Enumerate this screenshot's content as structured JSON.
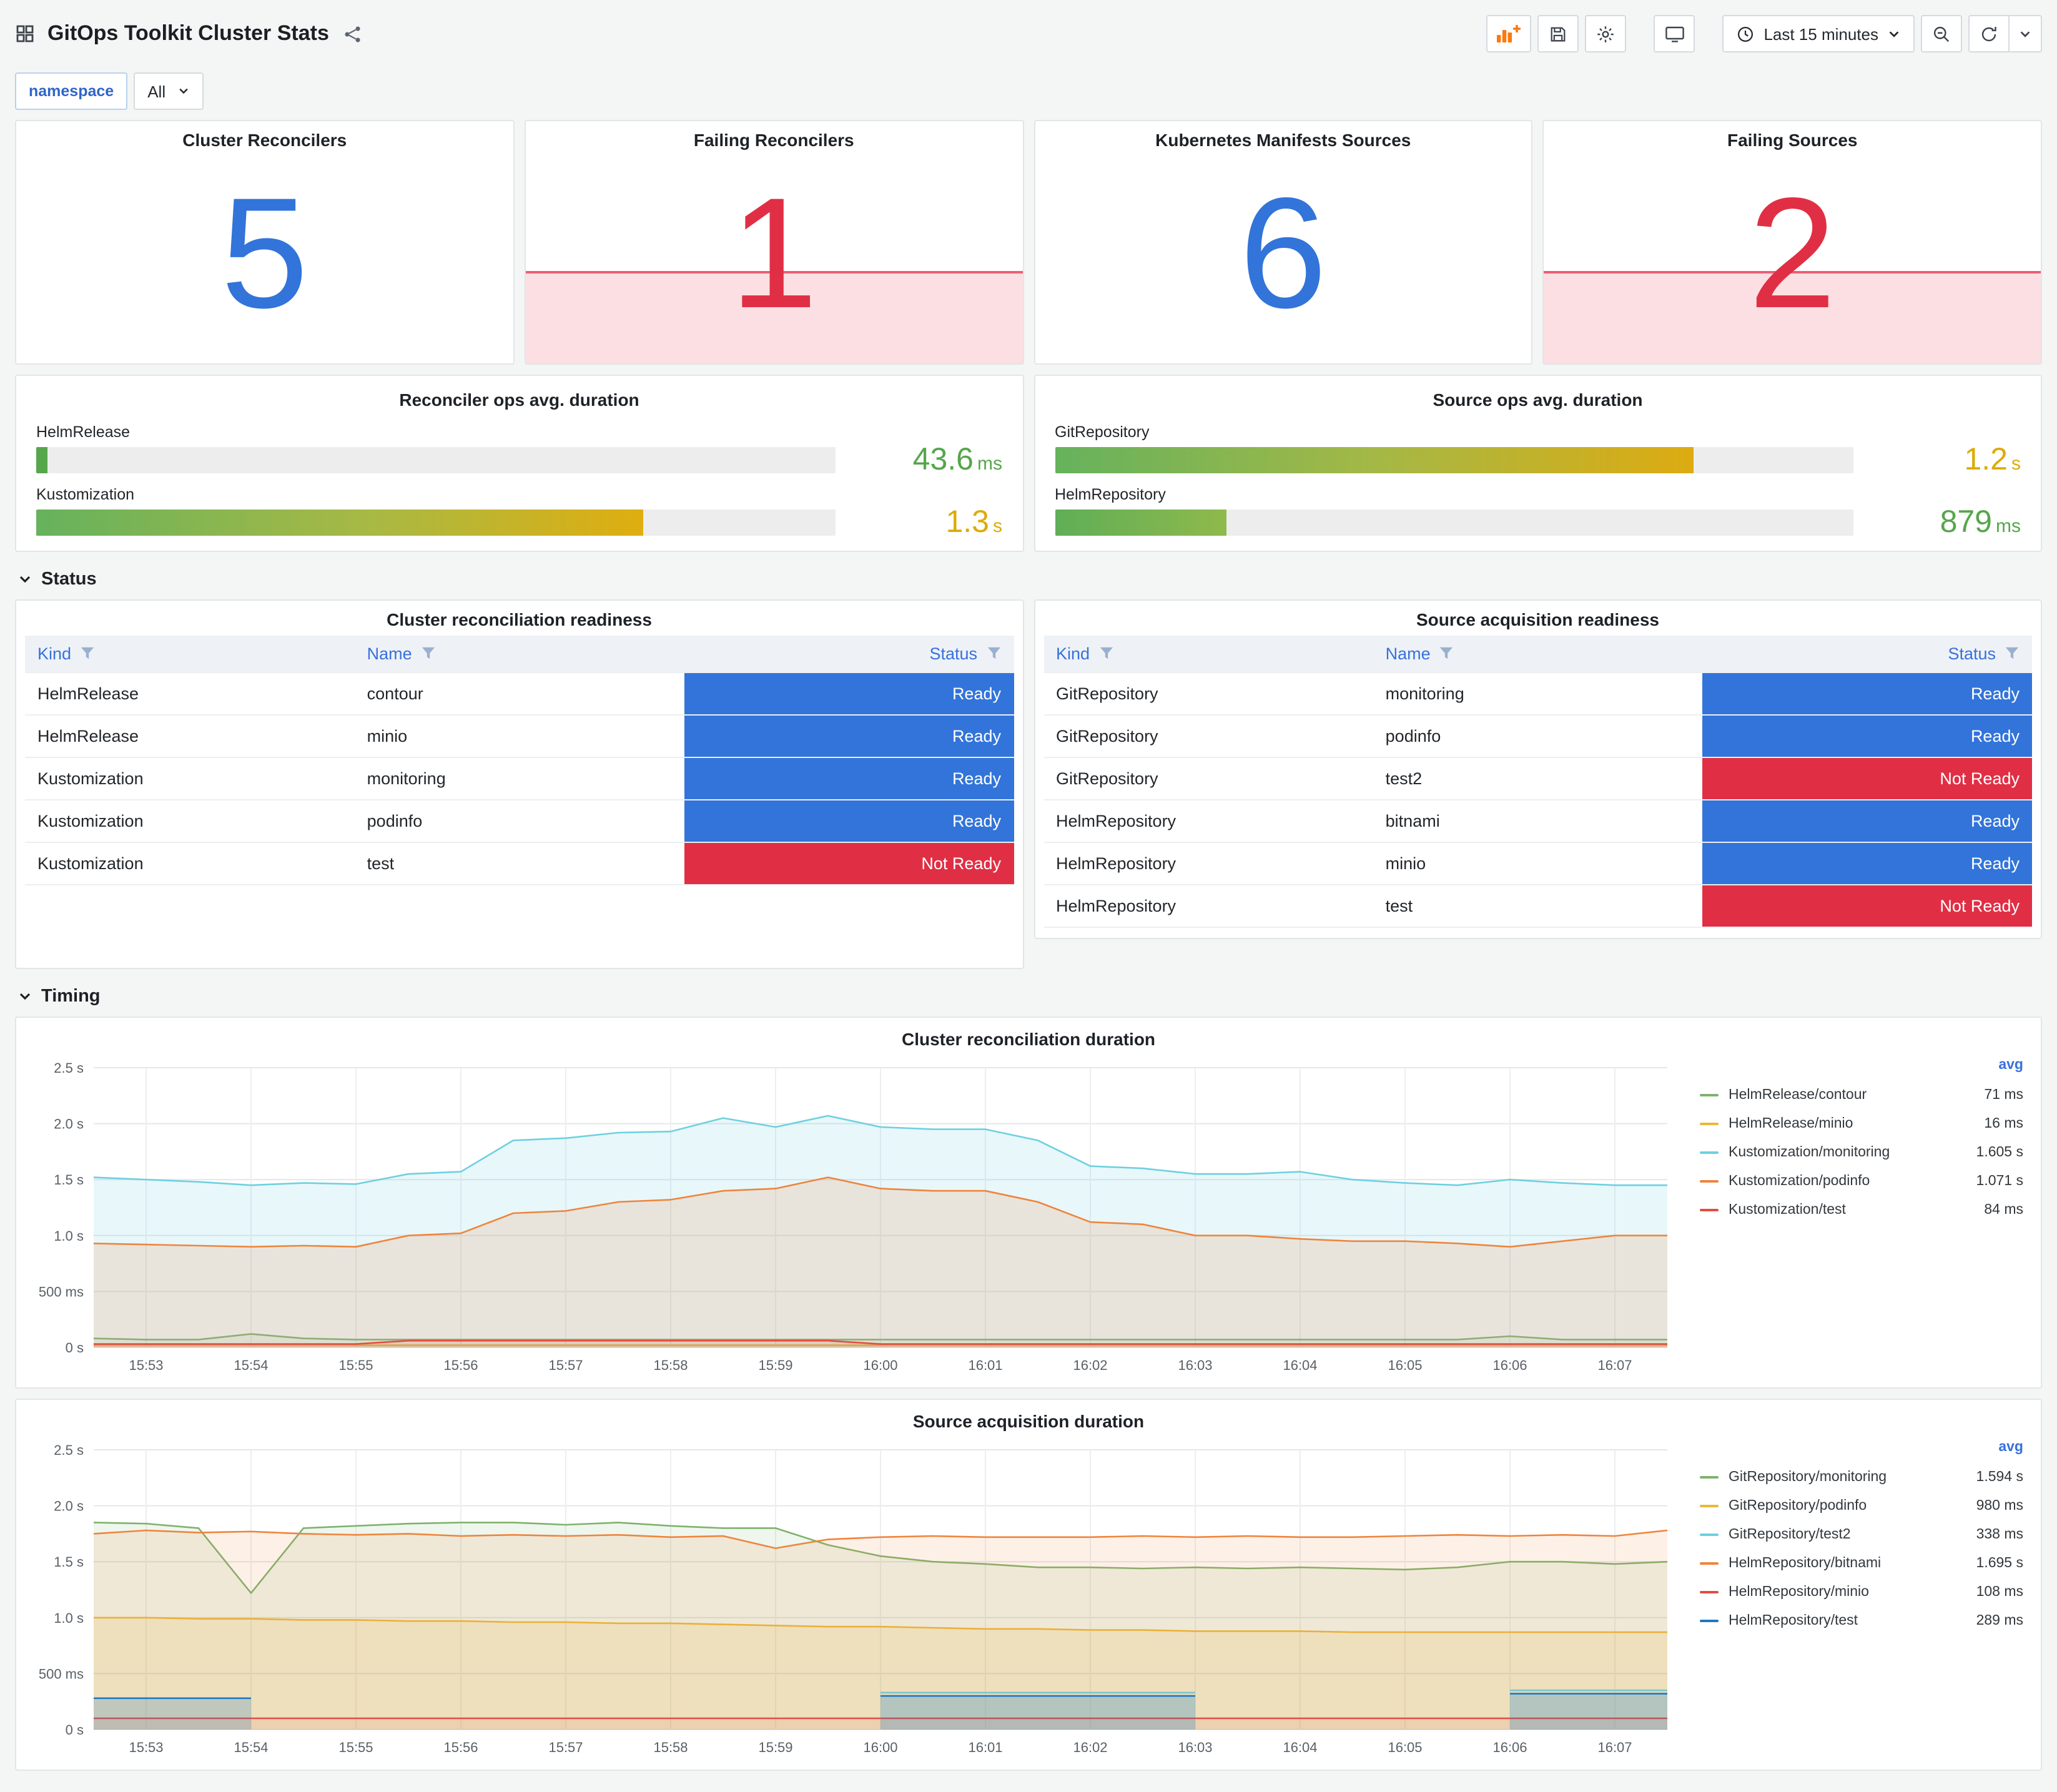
{
  "header": {
    "title": "GitOps Toolkit Cluster Stats",
    "time_range": "Last 15 minutes"
  },
  "filters": {
    "namespace_label": "namespace",
    "namespace_value": "All"
  },
  "stats": [
    {
      "title": "Cluster Reconcilers",
      "value": "5",
      "color": "#3274d9",
      "spark": false
    },
    {
      "title": "Failing Reconcilers",
      "value": "1",
      "color": "#e02f44",
      "spark": true
    },
    {
      "title": "Kubernetes Manifests Sources",
      "value": "6",
      "color": "#3274d9",
      "spark": false
    },
    {
      "title": "Failing Sources",
      "value": "2",
      "color": "#e02f44",
      "spark": true
    }
  ],
  "gauges": {
    "reconciler": {
      "title": "Reconciler ops avg. duration",
      "rows": [
        {
          "label": "HelmRelease",
          "value": "43.6",
          "unit": "ms",
          "percent": "1.4%",
          "valueColor": "#56a64b",
          "fill": "#56a64b"
        },
        {
          "label": "Kustomization",
          "value": "1.3",
          "unit": "s",
          "percent": "76%",
          "valueColor": "#dcab09",
          "fill": "linear-gradient(90deg,#66b25d 0%,#a8b944 55%,#dfae10 100%)"
        }
      ]
    },
    "source": {
      "title": "Source ops avg. duration",
      "rows": [
        {
          "label": "GitRepository",
          "value": "1.2",
          "unit": "s",
          "percent": "80%",
          "valueColor": "#dcab09",
          "fill": "linear-gradient(90deg,#66b25d 0%,#a4b846 50%,#ddab12 100%)"
        },
        {
          "label": "HelmRepository",
          "value": "879",
          "unit": "ms",
          "percent": "21.5%",
          "valueColor": "#56a64b",
          "fill": "linear-gradient(90deg,#5fae57,#8fb94c)"
        }
      ]
    }
  },
  "sections": {
    "status": "Status",
    "timing": "Timing"
  },
  "status_colors": {
    "Ready": "#3274d9",
    "Not Ready": "#e02f44"
  },
  "status": {
    "reconciliation": {
      "title": "Cluster reconciliation readiness",
      "columns": [
        "Kind",
        "Name",
        "Status"
      ],
      "rows": [
        [
          "HelmRelease",
          "contour",
          "Ready"
        ],
        [
          "HelmRelease",
          "minio",
          "Ready"
        ],
        [
          "Kustomization",
          "monitoring",
          "Ready"
        ],
        [
          "Kustomization",
          "podinfo",
          "Ready"
        ],
        [
          "Kustomization",
          "test",
          "Not Ready"
        ]
      ]
    },
    "source": {
      "title": "Source acquisition readiness",
      "columns": [
        "Kind",
        "Name",
        "Status"
      ],
      "rows": [
        [
          "GitRepository",
          "monitoring",
          "Ready"
        ],
        [
          "GitRepository",
          "podinfo",
          "Ready"
        ],
        [
          "GitRepository",
          "test2",
          "Not Ready"
        ],
        [
          "HelmRepository",
          "bitnami",
          "Ready"
        ],
        [
          "HelmRepository",
          "minio",
          "Ready"
        ],
        [
          "HelmRepository",
          "test",
          "Not Ready"
        ]
      ]
    }
  },
  "chart_data": [
    {
      "type": "line",
      "title": "Cluster reconciliation duration",
      "legend_header": "avg",
      "legend_position": "right",
      "grid": true,
      "ylim": [
        0,
        2.5
      ],
      "y_ticks": [
        {
          "v": 0,
          "label": "0 s"
        },
        {
          "v": 0.5,
          "label": "500 ms"
        },
        {
          "v": 1,
          "label": "1.0 s"
        },
        {
          "v": 1.5,
          "label": "1.5 s"
        },
        {
          "v": 2,
          "label": "2.0 s"
        },
        {
          "v": 2.5,
          "label": "2.5 s"
        }
      ],
      "x_ticks": [
        "15:53",
        "15:54",
        "15:55",
        "15:56",
        "15:57",
        "15:58",
        "15:59",
        "16:00",
        "16:01",
        "16:02",
        "16:03",
        "16:04",
        "16:05",
        "16:06",
        "16:07"
      ],
      "series": [
        {
          "name": "HelmRelease/contour",
          "avg": "71 ms",
          "color": "#7EB26D",
          "fill_opacity": 0.1,
          "values": [
            0.08,
            0.07,
            0.07,
            0.12,
            0.08,
            0.07,
            0.07,
            0.07,
            0.07,
            0.07,
            0.07,
            0.07,
            0.07,
            0.07,
            0.07,
            0.07,
            0.07,
            0.07,
            0.07,
            0.07,
            0.07,
            0.07,
            0.07,
            0.07,
            0.07,
            0.07,
            0.07,
            0.1,
            0.07,
            0.07,
            0.07
          ]
        },
        {
          "name": "HelmRelease/minio",
          "avg": "16 ms",
          "color": "#EAB839",
          "fill_opacity": 0.1,
          "values": [
            0.02,
            0.02,
            0.02,
            0.02,
            0.02,
            0.02,
            0.02,
            0.02,
            0.02,
            0.02,
            0.02,
            0.02,
            0.02,
            0.02,
            0.02,
            0.02,
            0.02,
            0.02,
            0.02,
            0.02,
            0.02,
            0.02,
            0.02,
            0.02,
            0.02,
            0.02,
            0.02,
            0.02,
            0.02,
            0.02,
            0.02
          ]
        },
        {
          "name": "Kustomization/monitoring",
          "avg": "1.605 s",
          "color": "#6ED0E0",
          "fill_opacity": 0.16,
          "values": [
            1.52,
            1.5,
            1.48,
            1.45,
            1.47,
            1.46,
            1.55,
            1.57,
            1.85,
            1.87,
            1.92,
            1.93,
            2.05,
            1.97,
            2.07,
            1.97,
            1.95,
            1.95,
            1.85,
            1.62,
            1.6,
            1.55,
            1.55,
            1.57,
            1.5,
            1.47,
            1.45,
            1.5,
            1.47,
            1.45,
            1.45
          ]
        },
        {
          "name": "Kustomization/podinfo",
          "avg": "1.071 s",
          "color": "#EF843C",
          "fill_opacity": 0.16,
          "values": [
            0.93,
            0.92,
            0.91,
            0.9,
            0.91,
            0.9,
            1.0,
            1.02,
            1.2,
            1.22,
            1.3,
            1.32,
            1.4,
            1.42,
            1.52,
            1.42,
            1.4,
            1.4,
            1.3,
            1.12,
            1.1,
            1.0,
            1.0,
            0.97,
            0.95,
            0.95,
            0.93,
            0.9,
            0.95,
            1.0,
            1.0
          ]
        },
        {
          "name": "Kustomization/test",
          "avg": "84 ms",
          "color": "#E24D42",
          "fill_opacity": 0.12,
          "values": [
            0.03,
            0.03,
            0.03,
            0.03,
            0.03,
            0.03,
            0.06,
            0.06,
            0.06,
            0.06,
            0.06,
            0.06,
            0.06,
            0.06,
            0.06,
            0.03,
            0.03,
            0.03,
            0.03,
            0.03,
            0.03,
            0.03,
            0.03,
            0.03,
            0.03,
            0.03,
            0.03,
            0.03,
            0.03,
            0.03,
            0.03
          ]
        }
      ]
    },
    {
      "type": "line",
      "title": "Source acquisition duration",
      "legend_header": "avg",
      "legend_position": "right",
      "grid": true,
      "ylim": [
        0,
        2.5
      ],
      "y_ticks": [
        {
          "v": 0,
          "label": "0 s"
        },
        {
          "v": 0.5,
          "label": "500 ms"
        },
        {
          "v": 1,
          "label": "1.0 s"
        },
        {
          "v": 1.5,
          "label": "1.5 s"
        },
        {
          "v": 2,
          "label": "2.0 s"
        },
        {
          "v": 2.5,
          "label": "2.5 s"
        }
      ],
      "x_ticks": [
        "15:53",
        "15:54",
        "15:55",
        "15:56",
        "15:57",
        "15:58",
        "15:59",
        "16:00",
        "16:01",
        "16:02",
        "16:03",
        "16:04",
        "16:05",
        "16:06",
        "16:07"
      ],
      "series": [
        {
          "name": "GitRepository/monitoring",
          "avg": "1.594 s",
          "color": "#7EB26D",
          "fill_opacity": 0.12,
          "values": [
            1.85,
            1.84,
            1.8,
            1.22,
            1.8,
            1.82,
            1.84,
            1.85,
            1.85,
            1.83,
            1.85,
            1.82,
            1.8,
            1.8,
            1.65,
            1.55,
            1.5,
            1.48,
            1.45,
            1.45,
            1.44,
            1.45,
            1.44,
            1.45,
            1.44,
            1.43,
            1.45,
            1.5,
            1.5,
            1.48,
            1.5
          ]
        },
        {
          "name": "GitRepository/podinfo",
          "avg": "980 ms",
          "color": "#EAB839",
          "fill_opacity": 0.16,
          "values": [
            1.0,
            1.0,
            0.99,
            0.99,
            0.98,
            0.98,
            0.97,
            0.97,
            0.96,
            0.96,
            0.95,
            0.95,
            0.94,
            0.93,
            0.92,
            0.92,
            0.91,
            0.9,
            0.9,
            0.89,
            0.89,
            0.88,
            0.88,
            0.88,
            0.87,
            0.87,
            0.87,
            0.87,
            0.87,
            0.87,
            0.87
          ]
        },
        {
          "name": "GitRepository/test2",
          "avg": "338 ms",
          "color": "#6ED0E0",
          "fill_opacity": 0.14,
          "values": [
            null,
            null,
            null,
            null,
            null,
            null,
            null,
            null,
            null,
            null,
            null,
            null,
            null,
            null,
            null,
            0.33,
            0.33,
            0.33,
            0.33,
            0.33,
            0.33,
            0.33,
            null,
            null,
            null,
            null,
            null,
            0.35,
            0.35,
            0.35,
            0.35
          ]
        },
        {
          "name": "HelmRepository/bitnami",
          "avg": "1.695 s",
          "color": "#EF843C",
          "fill_opacity": 0.12,
          "values": [
            1.75,
            1.78,
            1.76,
            1.77,
            1.75,
            1.74,
            1.75,
            1.73,
            1.74,
            1.73,
            1.74,
            1.72,
            1.73,
            1.62,
            1.7,
            1.72,
            1.73,
            1.72,
            1.72,
            1.72,
            1.73,
            1.72,
            1.73,
            1.72,
            1.72,
            1.73,
            1.74,
            1.73,
            1.74,
            1.73,
            1.78
          ]
        },
        {
          "name": "HelmRepository/minio",
          "avg": "108 ms",
          "color": "#E24D42",
          "fill_opacity": 0.1,
          "values": [
            0.1,
            0.1,
            0.1,
            0.1,
            0.1,
            0.1,
            0.1,
            0.1,
            0.1,
            0.1,
            0.1,
            0.1,
            0.1,
            0.1,
            0.1,
            0.1,
            0.1,
            0.1,
            0.1,
            0.1,
            0.1,
            0.1,
            0.1,
            0.1,
            0.1,
            0.1,
            0.1,
            0.1,
            0.1,
            0.1,
            0.1
          ]
        },
        {
          "name": "HelmRepository/test",
          "avg": "289 ms",
          "color": "#1F78C1",
          "fill_opacity": 0.22,
          "values": [
            0.28,
            0.28,
            0.28,
            0.28,
            null,
            null,
            null,
            null,
            null,
            null,
            null,
            null,
            null,
            null,
            null,
            0.3,
            0.3,
            0.3,
            0.3,
            0.3,
            0.3,
            0.3,
            null,
            null,
            null,
            null,
            null,
            0.32,
            0.32,
            0.32,
            0.32
          ]
        }
      ]
    }
  ]
}
